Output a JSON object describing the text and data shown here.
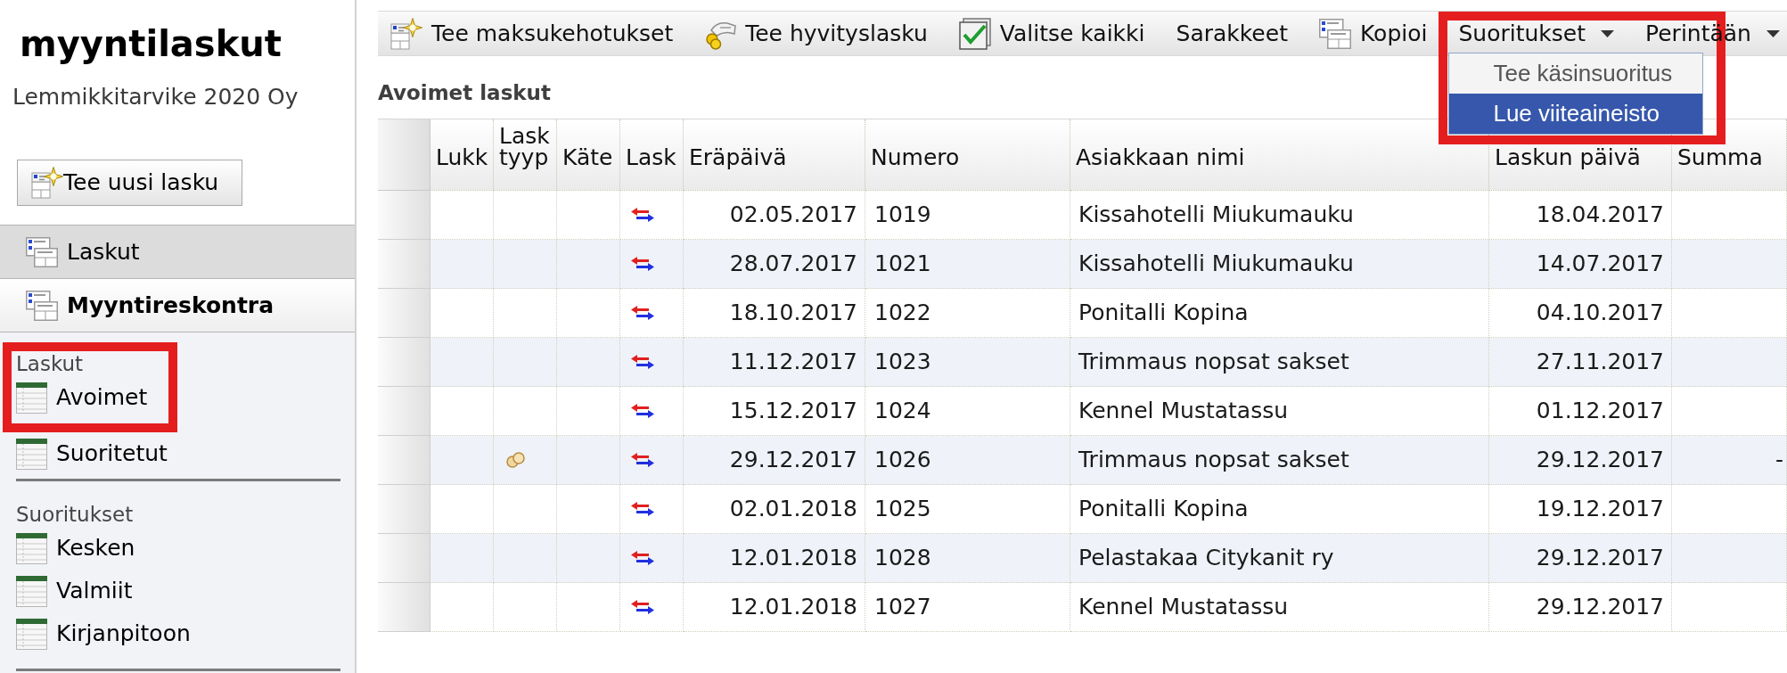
{
  "sidebar": {
    "title": "myyntilaskut",
    "subtitle": "Lemmikkitarvike 2020 Oy",
    "new_button": "Tee uusi lasku",
    "nav": [
      {
        "label": "Laskut",
        "expanded": false
      },
      {
        "label": "Myyntireskontra",
        "expanded": true
      }
    ],
    "sections": [
      {
        "label": "Laskut",
        "highlighted": true,
        "items": [
          {
            "label": "Avoimet",
            "highlighted": true
          },
          {
            "label": "Suoritetut",
            "highlighted": false
          }
        ]
      },
      {
        "label": "Suoritukset",
        "highlighted": false,
        "items": [
          {
            "label": "Kesken",
            "highlighted": false
          },
          {
            "label": "Valmiit",
            "highlighted": false
          },
          {
            "label": "Kirjanpitoon",
            "highlighted": false
          }
        ]
      }
    ]
  },
  "toolbar": {
    "items": [
      {
        "kind": "create",
        "label": "Tee maksukehotukset"
      },
      {
        "kind": "credit",
        "label": "Tee hyvityslasku"
      },
      {
        "kind": "select",
        "label": "Valitse kaikki"
      },
      {
        "kind": "text",
        "label": "Sarakkeet"
      },
      {
        "kind": "copy",
        "label": "Kopioi"
      },
      {
        "kind": "menu",
        "label": "Suoritukset",
        "highlighted": true,
        "options": [
          {
            "label": "Tee käsinsuoritus",
            "selected": false
          },
          {
            "label": "Lue viiteaineisto",
            "selected": true
          }
        ]
      },
      {
        "kind": "menu",
        "label": "Perintään",
        "highlighted": false
      }
    ]
  },
  "table": {
    "title": "Avoimet laskut",
    "columns": [
      "Lukk",
      "Lask tyyp",
      "Käte",
      "Lask",
      "Eräpäivä",
      "Numero",
      "Asiakkaan nimi",
      "Laskun päivä",
      "Summa"
    ],
    "rows": [
      {
        "type_icon": false,
        "due_date": "02.05.2017",
        "number": "1019",
        "customer": "Kissahotelli Miukumauku",
        "invoice_date": "18.04.2017"
      },
      {
        "type_icon": false,
        "due_date": "28.07.2017",
        "number": "1021",
        "customer": "Kissahotelli Miukumauku",
        "invoice_date": "14.07.2017"
      },
      {
        "type_icon": false,
        "due_date": "18.10.2017",
        "number": "1022",
        "customer": "Ponitalli Kopina",
        "invoice_date": "04.10.2017"
      },
      {
        "type_icon": false,
        "due_date": "11.12.2017",
        "number": "1023",
        "customer": "Trimmaus nopsat sakset",
        "invoice_date": "27.11.2017"
      },
      {
        "type_icon": false,
        "due_date": "15.12.2017",
        "number": "1024",
        "customer": "Kennel Mustatassu",
        "invoice_date": "01.12.2017"
      },
      {
        "type_icon": true,
        "due_date": "29.12.2017",
        "number": "1026",
        "customer": "Trimmaus nopsat sakset",
        "invoice_date": "29.12.2017",
        "sum": "-"
      },
      {
        "type_icon": false,
        "due_date": "02.01.2018",
        "number": "1025",
        "customer": "Ponitalli Kopina",
        "invoice_date": "19.12.2017"
      },
      {
        "type_icon": false,
        "due_date": "12.01.2018",
        "number": "1028",
        "customer": "Pelastakaa Citykanit ry",
        "invoice_date": "29.12.2017"
      },
      {
        "type_icon": false,
        "due_date": "12.01.2018",
        "number": "1027",
        "customer": "Kennel Mustatassu",
        "invoice_date": "29.12.2017"
      }
    ]
  }
}
